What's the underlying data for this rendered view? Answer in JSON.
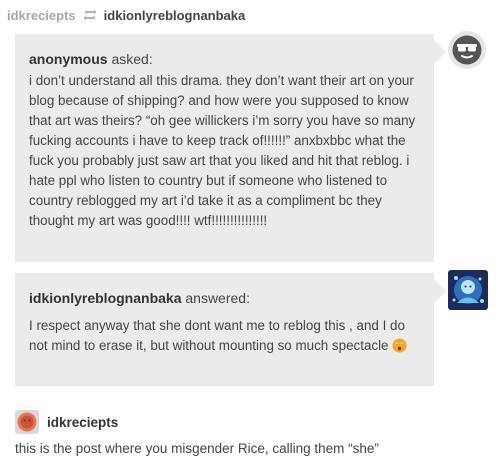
{
  "reblog_trail": {
    "source": "idkreciepts",
    "target": "idkionlyreblognanbaka"
  },
  "ask": {
    "asker": "anonymous",
    "asked_label": "asked:",
    "text": "i don’t understand all this drama. they don’t want their art on your blog because of shipping? and how were you supposed to know that art was theirs? “oh gee willickers i’m sorry you have so many fucking accounts i have to keep track of!!!!!!” anxbxbbc what the fuck you probably just saw art that you liked and hit that reblog. i hate ppl who listen to country but if someone who listened to country reblogged my art i’d take it as a compliment bc they thought my art was good!!!! wtf!!!!!!!!!!!!!!!"
  },
  "answer": {
    "answerer": "idkionlyreblognanbaka",
    "answered_label": "answered:",
    "text": "I respect anyway that she dont want me to reblog this , and I do not mind to erase it, but without mounting so much spectacle",
    "emoji": "astonished-face-emoji"
  },
  "post": {
    "author": "idkreciepts",
    "body": "this is the post where you misgender Rice, calling them “she”"
  },
  "colors": {
    "bubble": "#ebebeb",
    "muted_text": "#a8a8a8",
    "text": "#444444"
  }
}
